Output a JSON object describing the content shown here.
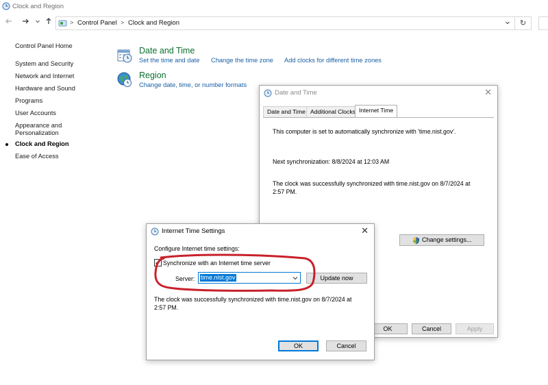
{
  "window": {
    "title": "Clock and Region"
  },
  "address": {
    "crumbs": [
      "Control Panel",
      "Clock and Region"
    ],
    "separator": ">"
  },
  "nav_icons": {
    "back": "‹",
    "forward": "›",
    "recent": "˅",
    "up": "↑",
    "refresh": "↻",
    "dropdown": "˅"
  },
  "sidebar": {
    "items": [
      {
        "label": "Control Panel Home"
      },
      {
        "label": "System and Security"
      },
      {
        "label": "Network and Internet"
      },
      {
        "label": "Hardware and Sound"
      },
      {
        "label": "Programs"
      },
      {
        "label": "User Accounts"
      },
      {
        "label": "Appearance and Personalization"
      },
      {
        "label": "Clock and Region",
        "active": true
      },
      {
        "label": "Ease of Access"
      }
    ]
  },
  "main": {
    "date_time": {
      "title": "Date and Time",
      "links": [
        "Set the time and date",
        "Change the time zone",
        "Add clocks for different time zones"
      ]
    },
    "region": {
      "title": "Region",
      "links": [
        "Change date, time, or number formats"
      ]
    }
  },
  "date_time_dialog": {
    "title": "Date and Time",
    "tabs": [
      "Date and Time",
      "Additional Clocks",
      "Internet Time"
    ],
    "active_tab": "Internet Time",
    "sync_status": "This computer is set to automatically synchronize with 'time.nist.gov'.",
    "next_sync": "Next synchronization: 8/8/2024 at 12:03 AM",
    "last_sync_line1": "The clock was successfully synchronized with time.nist.gov on 8/7/2024 at",
    "last_sync_line2": "2:57 PM.",
    "change_settings": "Change settings...",
    "ok": "OK",
    "cancel": "Cancel",
    "apply": "Apply"
  },
  "internet_time_dialog": {
    "title": "Internet Time Settings",
    "heading": "Configure Internet time settings:",
    "sync_checkbox_label": "Synchronize with an Internet time server",
    "sync_checked": true,
    "server_label": "Server:",
    "server_value": "time.nist.gov",
    "update_now": "Update now",
    "status_line1": "The clock was successfully synchronized with time.nist.gov on 8/7/2024 at",
    "status_line2": "2:57 PM.",
    "ok": "OK",
    "cancel": "Cancel",
    "close": "✕"
  },
  "colors": {
    "category_title": "#0a6e2e",
    "link": "#1a5fa5",
    "highlight_circle": "#c8202a",
    "selection": "#0078d7"
  }
}
